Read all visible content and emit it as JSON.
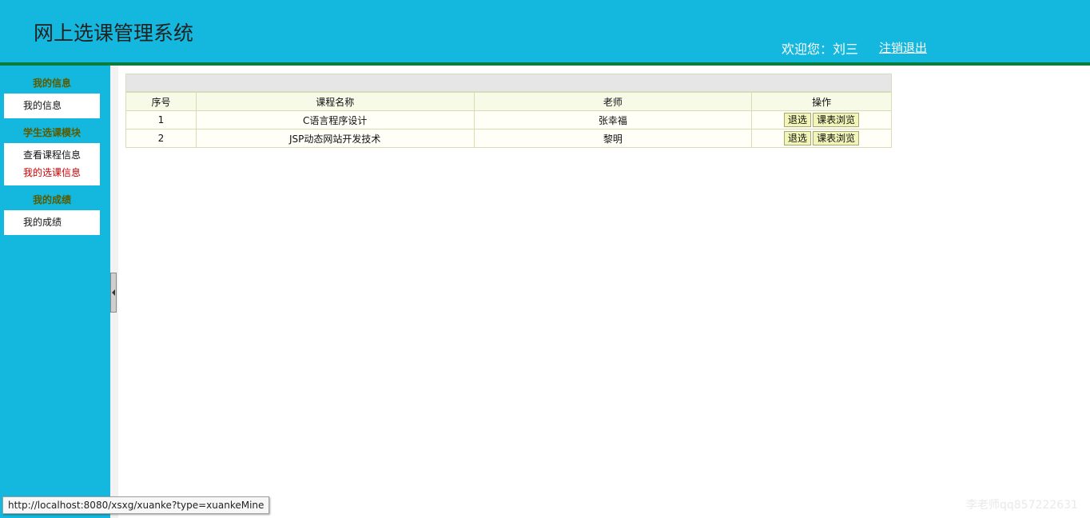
{
  "header": {
    "title": "网上选课管理系统",
    "welcome": "欢迎您：刘三",
    "logout": "注销退出"
  },
  "sidebar": {
    "sections": [
      {
        "title": "我的信息",
        "items": [
          "我的信息"
        ]
      },
      {
        "title": "学生选课模块",
        "items": [
          "查看课程信息",
          "我的选课信息"
        ]
      },
      {
        "title": "我的成绩",
        "items": [
          "我的成绩"
        ]
      }
    ],
    "active_item": "我的选课信息"
  },
  "table": {
    "columns": [
      "序号",
      "课程名称",
      "老师",
      "操作"
    ],
    "rows": [
      {
        "no": "1",
        "course": "C语言程序设计",
        "teacher": "张幸福",
        "actions": [
          "退选",
          "课表浏览"
        ]
      },
      {
        "no": "2",
        "course": "JSP动态网站开发技术",
        "teacher": "黎明",
        "actions": [
          "退选",
          "课表浏览"
        ]
      }
    ]
  },
  "statusbar": {
    "url": "http://localhost:8080/xsxg/xuanke?type=xuankeMine"
  },
  "watermark": "李老师qq857222631",
  "colors": {
    "header_bg": "#14b8de",
    "header_rule": "#0a7d3c",
    "active_item": "#cc0000",
    "section_title": "#5a5a00"
  }
}
